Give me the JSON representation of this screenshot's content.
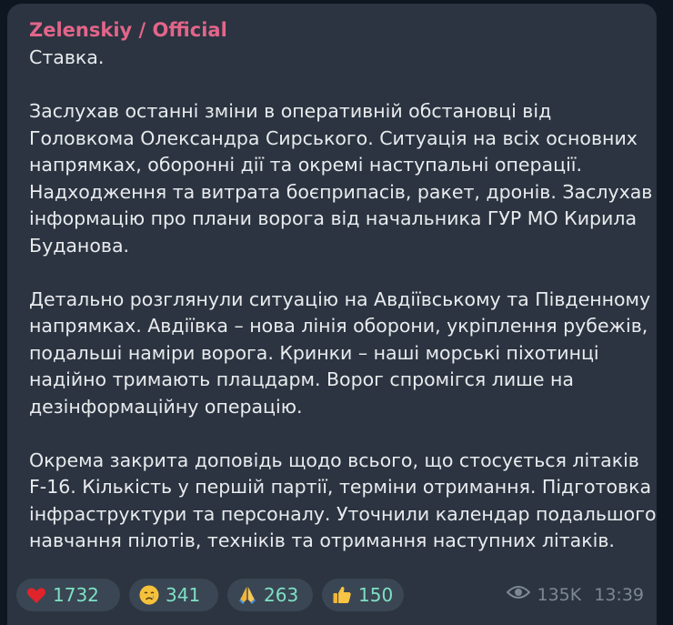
{
  "message": {
    "author": "Zelenskiy / Official",
    "paragraphs": [
      [
        "Ставка."
      ],
      [
        "Заслухав останні зміни в оперативній обстановці від",
        "Головкома Олександра Сирського. Ситуація на всіх основних",
        "напрямках, оборонні дії та окремі наступальні операції.",
        "Надходження та витрата боєприпасів, ракет, дронів. Заслухав",
        "інформацію про плани ворога від начальника ГУР МО Кирила",
        "Буданова."
      ],
      [
        "Детально розглянули ситуацію на Авдіївському та Південному",
        "напрямках. Авдіївка – нова лінія оборони, укріплення рубежів,",
        "подальші наміри ворога. Кринки – наші морські піхотинці",
        "надійно тримають плацдарм. Ворог спромігся лише на",
        "дезінформаційну операцію."
      ],
      [
        "Окрема закрита доповідь щодо всього, що стосується літаків",
        "F-16. Кількість у першій партії, терміни отримання. Підготовка",
        "інфраструктури та персоналу. Уточнили календар подальшого",
        "навчання пілотів, техніків та отримання наступних літаків."
      ]
    ],
    "reactions": [
      {
        "icon": "heart-icon",
        "count": "1732"
      },
      {
        "icon": "crying-face-icon",
        "count": "341"
      },
      {
        "icon": "praying-hands-icon",
        "count": "263"
      },
      {
        "icon": "thumbs-up-icon",
        "count": "150"
      }
    ],
    "views": "135K",
    "time": "13:39"
  },
  "colors": {
    "background": "#0e1621",
    "bubble": "#2b3440",
    "author": "#e2658a",
    "reaction_pill": "#3a4653",
    "reaction_count": "#7ee0c5",
    "meta": "#7d8895"
  }
}
